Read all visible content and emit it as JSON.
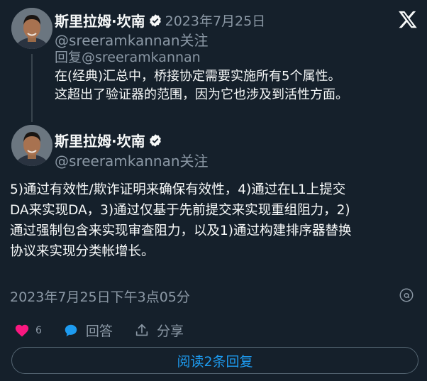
{
  "icons": {
    "x": "x-logo-icon",
    "verified": "verified-badge-icon",
    "like": "heart-icon",
    "reply": "reply-bubble-icon",
    "share": "share-icon",
    "info": "info-icon"
  },
  "colors": {
    "background": "#15202b",
    "accent": "#1d9bf0",
    "like": "#f91880",
    "muted": "#8b98a5",
    "text": "#f7f9f9"
  },
  "parent_tweet": {
    "author_name": "斯里拉姆·坎南",
    "date": "2023年7月25日",
    "handle": "@sreeramkannan",
    "follow": "关注",
    "reply_to": "回复@sreeramkannan",
    "text_line1": "在(经典)汇总中，桥接协定需要实施所有5个属性。",
    "text_line2": "这超出了验证器的范围，因为它也涉及到活性方面。"
  },
  "main_tweet": {
    "author_name": "斯里拉姆·坎南",
    "handle": "@sreeramkannan",
    "follow": "关注",
    "text_line1": "5)通过有效性/欺诈证明来确保有效性，4)通过在L1上提交",
    "text_line2": "DA来实现DA，3)通过仅基于先前提交来实现重组阻力，2)",
    "text_line3": "通过强制包含来实现审查阻力，以及1)通过构建排序器替换",
    "text_line4": "协议来实现分类帐增长。",
    "timestamp": "2023年7月25日下午3点05分"
  },
  "actions": {
    "like_count": "6",
    "reply_label": "回答",
    "share_label": "分享"
  },
  "read_replies_label": "阅读2条回复"
}
